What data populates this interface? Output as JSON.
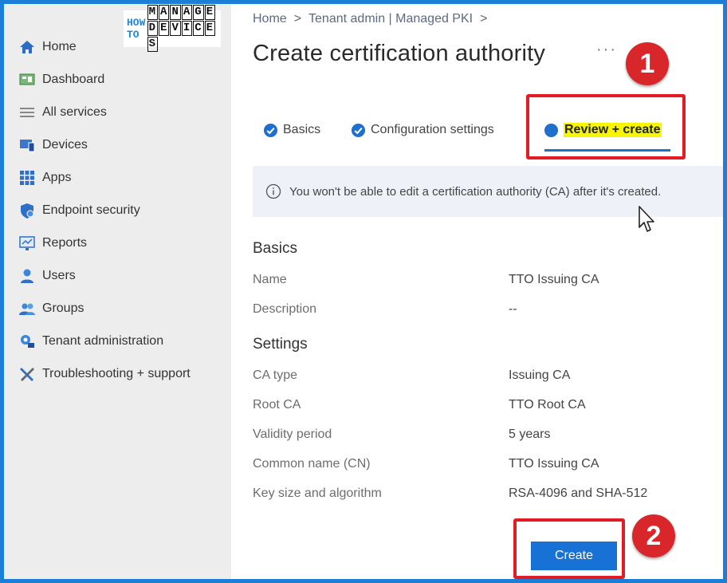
{
  "logo": {
    "how": "HOW",
    "to": "TO",
    "manage": [
      "M",
      "A",
      "N",
      "A",
      "G",
      "E"
    ],
    "devices": [
      "D",
      "E",
      "V",
      "I",
      "C",
      "E",
      "S"
    ]
  },
  "sidebar": {
    "items": [
      {
        "label": "Home",
        "icon": "home-icon"
      },
      {
        "label": "Dashboard",
        "icon": "dashboard-icon"
      },
      {
        "label": "All services",
        "icon": "list-icon"
      },
      {
        "label": "Devices",
        "icon": "devices-icon"
      },
      {
        "label": "Apps",
        "icon": "apps-grid-icon"
      },
      {
        "label": "Endpoint security",
        "icon": "shield-icon"
      },
      {
        "label": "Reports",
        "icon": "reports-icon"
      },
      {
        "label": "Users",
        "icon": "user-icon"
      },
      {
        "label": "Groups",
        "icon": "groups-icon"
      },
      {
        "label": "Tenant administration",
        "icon": "tenant-admin-icon"
      },
      {
        "label": "Troubleshooting + support",
        "icon": "wrench-icon"
      }
    ]
  },
  "breadcrumb": {
    "items": [
      "Home",
      "Tenant admin | Managed PKI"
    ],
    "separator": ">"
  },
  "page": {
    "title": "Create certification authority",
    "more": "···"
  },
  "annotations": {
    "step1": "1",
    "step2": "2"
  },
  "tabs": [
    {
      "label": "Basics",
      "state": "complete"
    },
    {
      "label": "Configuration settings",
      "state": "complete"
    },
    {
      "label": "Review + create",
      "state": "current"
    }
  ],
  "info": {
    "text": "You won't be able to edit a certification authority (CA) after it's created."
  },
  "basics": {
    "heading": "Basics",
    "rows": [
      {
        "key": "Name",
        "value": "TTO Issuing CA"
      },
      {
        "key": "Description",
        "value": "--"
      }
    ]
  },
  "settings": {
    "heading": "Settings",
    "rows": [
      {
        "key": "CA type",
        "value": "Issuing CA"
      },
      {
        "key": "Root CA",
        "value": "TTO Root CA"
      },
      {
        "key": "Validity period",
        "value": "5 years"
      },
      {
        "key": "Common name (CN)",
        "value": "TTO Issuing CA"
      },
      {
        "key": "Key size and algorithm",
        "value": "RSA-4096 and SHA-512"
      }
    ]
  },
  "actions": {
    "create_label": "Create"
  },
  "colors": {
    "accent": "#1872d6",
    "highlight": "#f6f600",
    "annotation": "#e21c22",
    "sidebar_bg": "#ededed"
  }
}
